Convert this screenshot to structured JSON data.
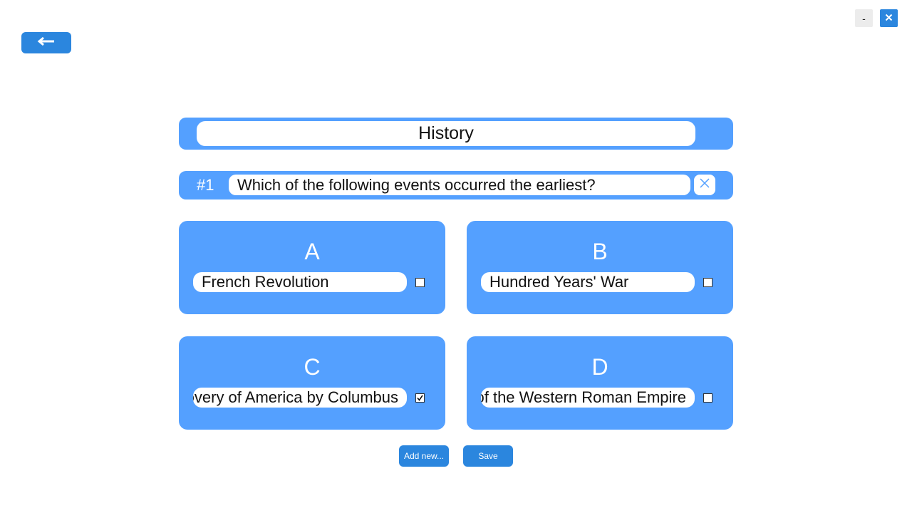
{
  "window": {
    "minimize_label": "-",
    "back_icon": "arrow-left-icon",
    "close_icon": "close-icon"
  },
  "quiz": {
    "title": "History"
  },
  "question": {
    "number": "#1",
    "text": "Which of the following events occurred the earliest?",
    "delete_icon": "x-icon"
  },
  "answers": [
    {
      "letter": "A",
      "text": "French Revolution",
      "checked": false
    },
    {
      "letter": "B",
      "text": "Hundred Years' War",
      "checked": false
    },
    {
      "letter": "C",
      "text": "Discovery of America by Columbus",
      "checked": true
    },
    {
      "letter": "D",
      "text": "Fall of the Western Roman Empire",
      "checked": false
    }
  ],
  "actions": {
    "add_new_label": "Add new...",
    "save_label": "Save"
  },
  "colors": {
    "accent": "#2b86de",
    "panel": "#54a0ff",
    "background": "#ffffff"
  }
}
